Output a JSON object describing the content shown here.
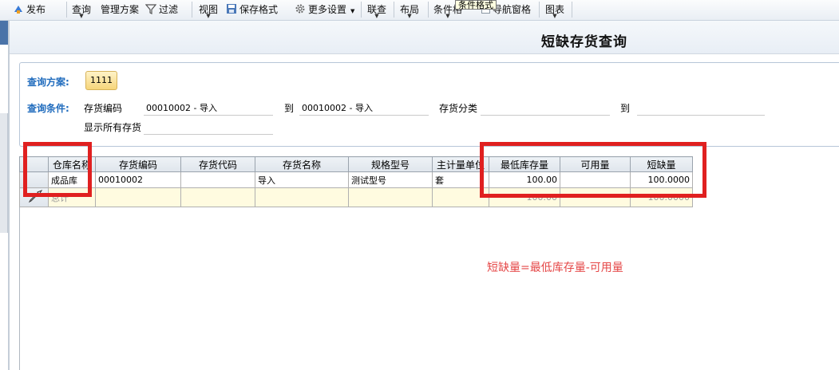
{
  "toolbar": {
    "publish": "发布",
    "query": "查询",
    "manage_plan": "管理方案",
    "filter": "过滤",
    "view": "视图",
    "save_format": "保存格式",
    "more_settings": "更多设置",
    "link_query": "联查",
    "layout": "布局",
    "condition": "条件格",
    "tooltip": "条件格式",
    "nav_pane": "导航窗格",
    "chart": "图表"
  },
  "page_title": "短缺存货查询",
  "query_panel": {
    "plan_label": "查询方案:",
    "plan_button": "1111",
    "condition_label": "查询条件:",
    "inv_code_label": "存货编码",
    "inv_code_from": "00010002 - 导入",
    "to_label_1": "到",
    "inv_code_to": "00010002 - 导入",
    "category_label": "存货分类",
    "category_from": "",
    "to_label_2": "到",
    "category_to": "",
    "show_all_label": "显示所有存货",
    "show_all_value": ""
  },
  "grid": {
    "columns": [
      "仓库名称",
      "存货编码",
      "存货代码",
      "存货名称",
      "规格型号",
      "主计量单位",
      "最低库存量",
      "可用量",
      "短缺量"
    ],
    "rows": [
      [
        "成品库",
        "00010002",
        "",
        "导入",
        "测试型号",
        "套",
        "100.00",
        "",
        "100.0000"
      ]
    ],
    "total_row": [
      "总计",
      "",
      "",
      "",
      "",
      "",
      "100.00",
      "",
      "100.0000"
    ]
  },
  "annotation": {
    "formula": "短缺量=最低库存量-可用量",
    "color": "#e02020"
  }
}
